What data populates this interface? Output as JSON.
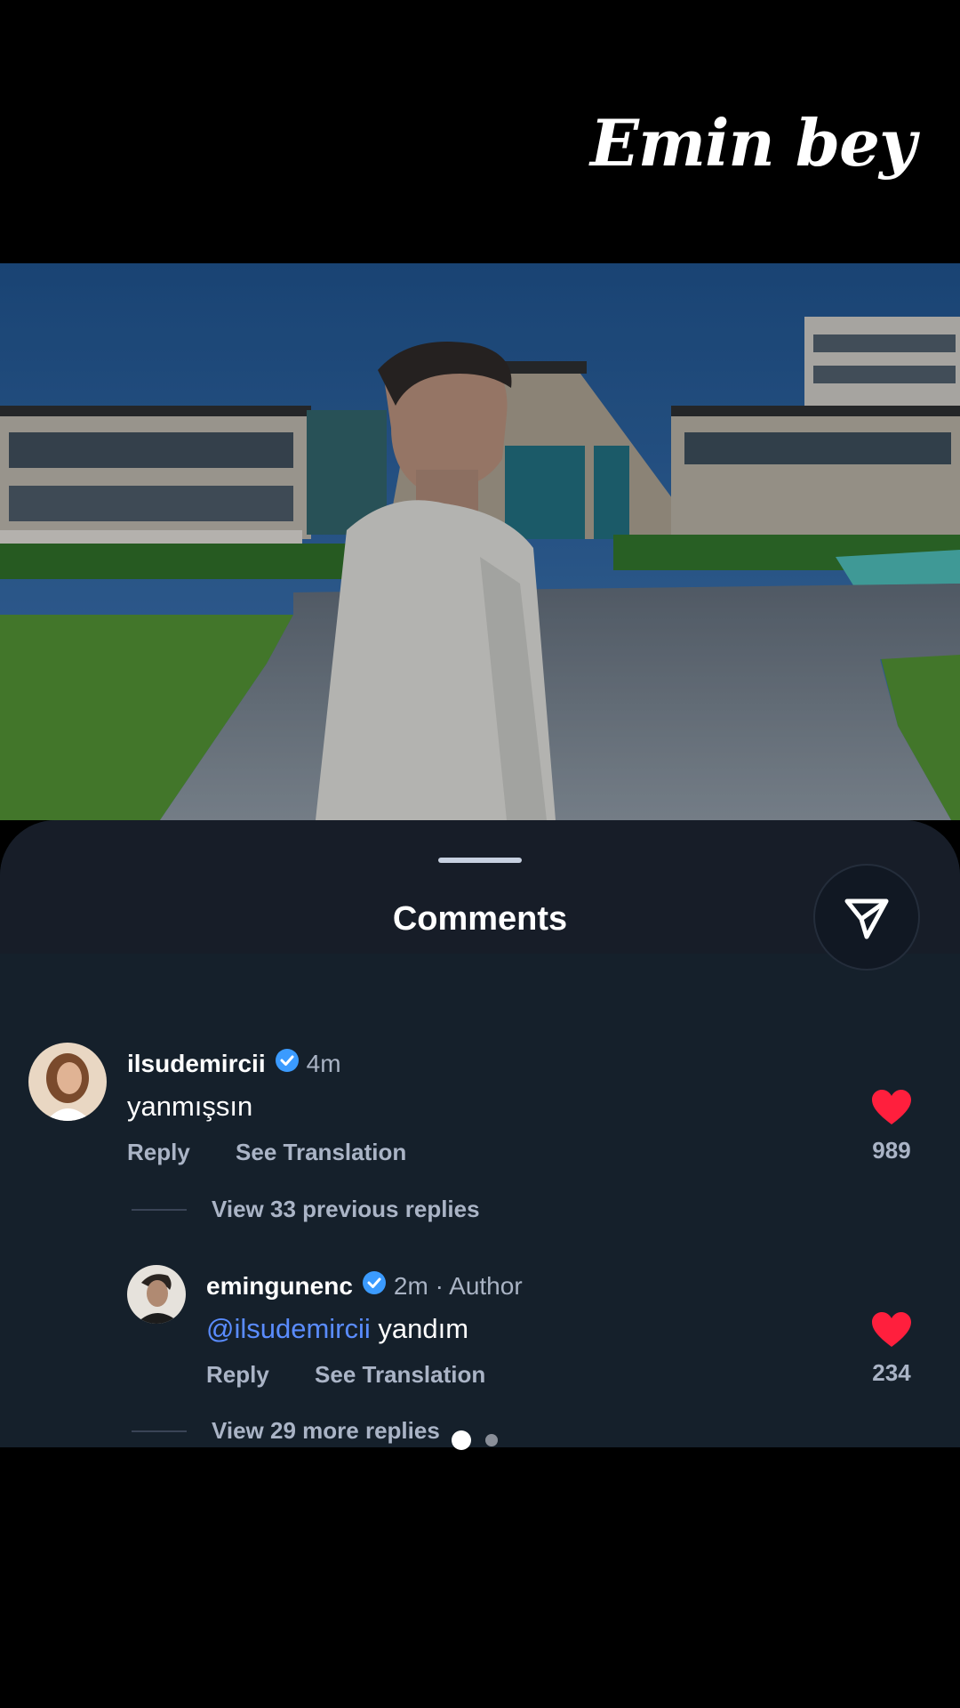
{
  "overlay_title": "Emin bey",
  "sheet": {
    "title": "Comments"
  },
  "comments": [
    {
      "username": "ilsudemircii",
      "verified": true,
      "time": "4m",
      "author_tag": "",
      "mention": "",
      "text": "yanmışsın",
      "reply_label": "Reply",
      "translate_label": "See Translation",
      "likes": "989",
      "replies_label": "View 33 previous replies"
    },
    {
      "username": "emingunenc",
      "verified": true,
      "time": "2m · Author",
      "mention": "@ilsudemircii",
      "text": "yandım",
      "reply_label": "Reply",
      "translate_label": "See Translation",
      "likes": "234",
      "replies_label": "View 29 more replies"
    }
  ],
  "colors": {
    "heart": "#ff1f3d",
    "mention": "#5a8cff",
    "sheet_bg": "#15202b"
  }
}
